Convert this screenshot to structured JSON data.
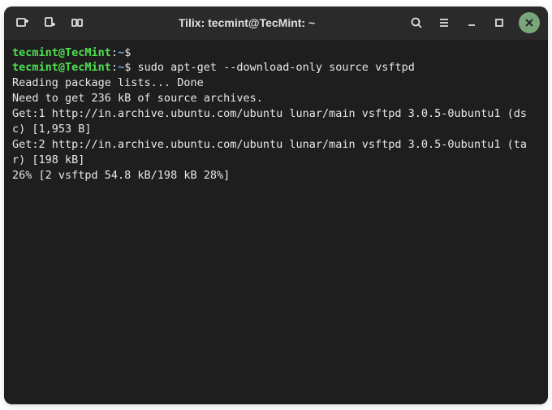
{
  "titlebar": {
    "title": "Tilix: tecmint@TecMint: ~"
  },
  "terminal": {
    "lines": [
      {
        "type": "prompt",
        "user": "tecmint@TecMint",
        "path": "~",
        "command": ""
      },
      {
        "type": "prompt",
        "user": "tecmint@TecMint",
        "path": "~",
        "command": "sudo apt-get --download-only source vsftpd"
      },
      {
        "type": "output",
        "text": "Reading package lists... Done"
      },
      {
        "type": "output",
        "text": "Need to get 236 kB of source archives."
      },
      {
        "type": "output",
        "text": "Get:1 http://in.archive.ubuntu.com/ubuntu lunar/main vsftpd 3.0.5-0ubuntu1 (dsc) [1,953 B]"
      },
      {
        "type": "output",
        "text": "Get:2 http://in.archive.ubuntu.com/ubuntu lunar/main vsftpd 3.0.5-0ubuntu1 (tar) [198 kB]"
      },
      {
        "type": "output",
        "text": "26% [2 vsftpd 54.8 kB/198 kB 28%]"
      }
    ]
  }
}
